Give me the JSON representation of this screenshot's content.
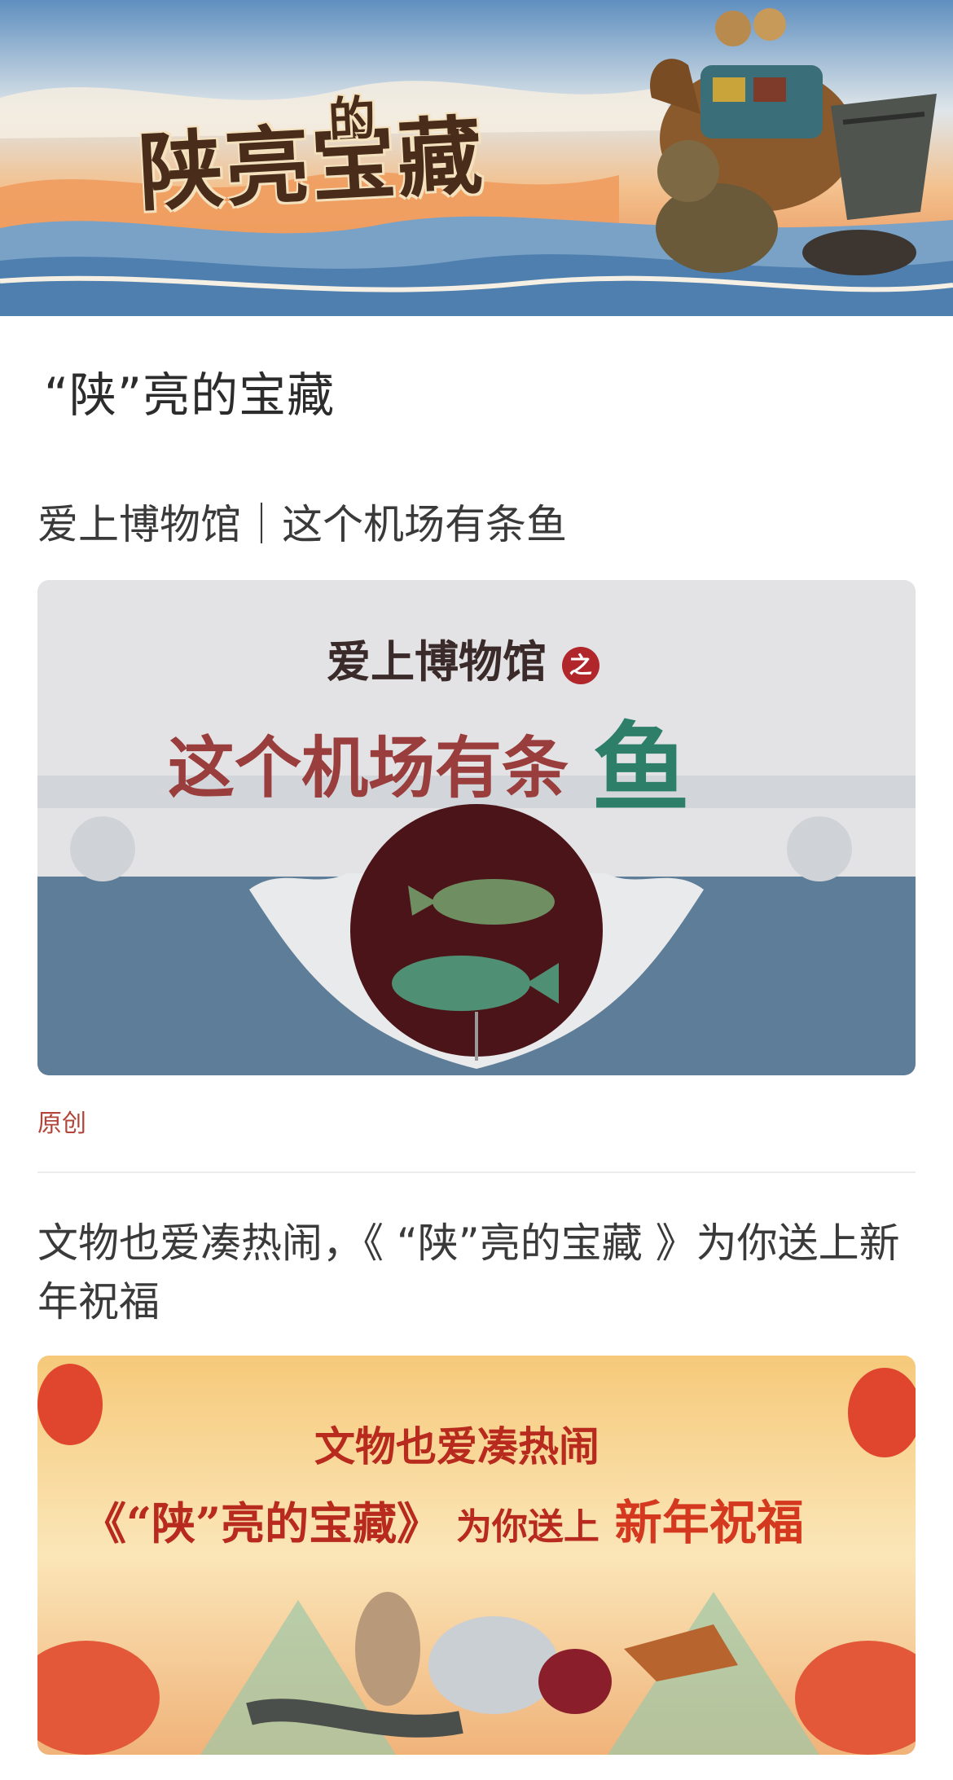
{
  "banner": {
    "logo_text": "陕亮宝藏",
    "logo_small": "的"
  },
  "page": {
    "title": "“陕”亮的宝藏"
  },
  "articles": [
    {
      "title": "爱上博物馆｜这个机场有条鱼",
      "thumb": {
        "line1": "爱上博物馆",
        "line1_suffix": "之",
        "line2": "这个机场有条",
        "line2_big": "鱼"
      },
      "badge": "原创"
    },
    {
      "title": "文物也爱凑热闹，《 “陕”亮的宝藏 》为你送上新年祝福",
      "thumb": {
        "line1": "文物也爱凑热闹",
        "line2a": "《“陕”亮的宝藏》",
        "line2b": "为你送上",
        "line2c": "新年祝福"
      }
    }
  ],
  "colors": {
    "badge": "#b2453a",
    "fish_bg_blue": "#5e7d98",
    "fish_plate": "#4a1418",
    "newyear_red": "#d94a2a"
  }
}
